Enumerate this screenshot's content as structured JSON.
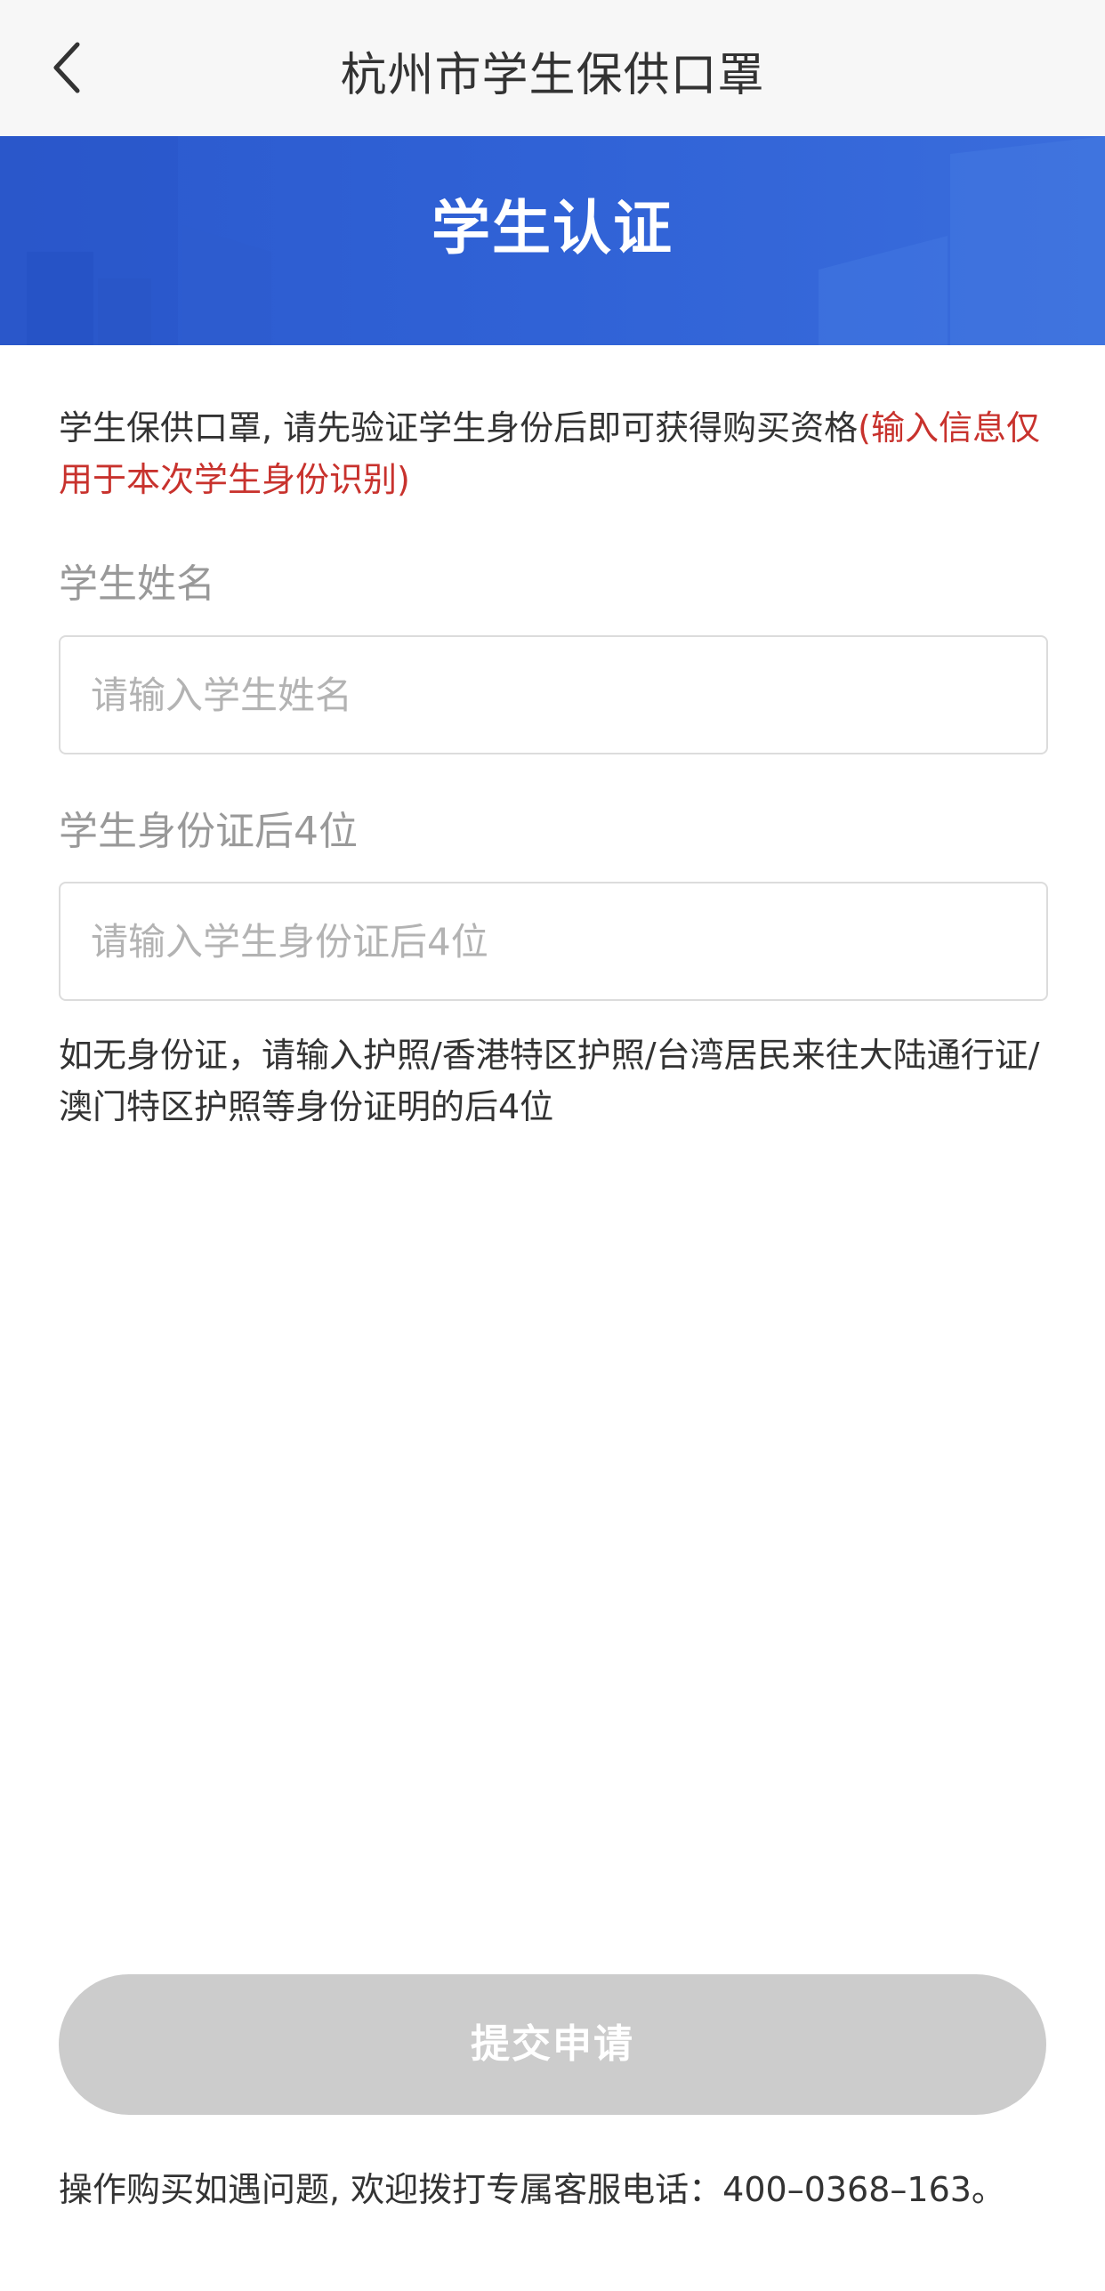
{
  "nav": {
    "title": "杭州市学生保供口罩",
    "back_icon": "chevron-left-icon"
  },
  "banner": {
    "title": "学生认证",
    "color": "#3062d6"
  },
  "intro": {
    "text": "学生保供口罩, 请先验证学生身份后即可获得购买资格",
    "highlight": "(输入信息仅用于本次学生身份识别)",
    "highlight_color": "#c8322d"
  },
  "form": {
    "name_label": "学生姓名",
    "name_placeholder": "请输入学生姓名",
    "id_label": "学生身份证后4位",
    "id_placeholder": "请输入学生身份证后4位",
    "hint": "如无身份证，请输入护照/香港特区护照/台湾居民来往大陆通行证/澳门特区护照等身份证明的后4位"
  },
  "submit": {
    "label": "提交申请",
    "color": "#cccccc"
  },
  "footer": {
    "note": "操作购买如遇问题, 欢迎拨打专属客服电话：400–0368–163。"
  }
}
